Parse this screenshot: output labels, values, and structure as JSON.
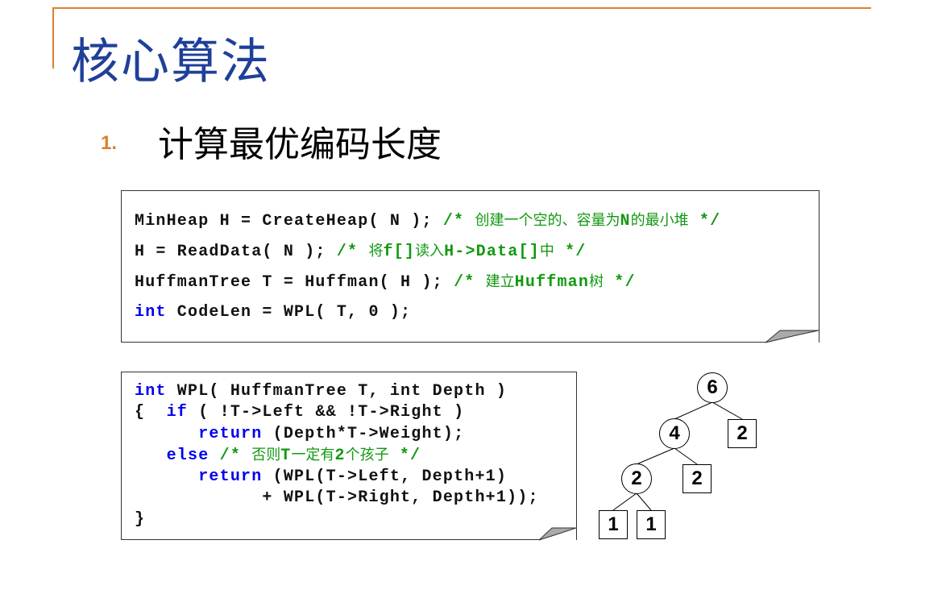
{
  "title": "核心算法",
  "section": {
    "number": "1.",
    "heading": "计算最优编码长度"
  },
  "colors": {
    "accent": "#d9822b",
    "title": "#1f3f99",
    "keyword": "#0000ee",
    "comment": "#119911"
  },
  "code_block_1": [
    [
      {
        "t": "MinHeap H = CreateHeap( N ); ",
        "c": ""
      },
      {
        "t": "/* ",
        "c": "cm"
      },
      {
        "t": "创建一个空的、容量为",
        "c": "cm zh"
      },
      {
        "t": "N",
        "c": "cm"
      },
      {
        "t": "的最小堆",
        "c": "cm zh"
      },
      {
        "t": " */",
        "c": "cm"
      }
    ],
    [
      {
        "t": "H = ReadData( N ); ",
        "c": ""
      },
      {
        "t": "/* ",
        "c": "cm"
      },
      {
        "t": "将",
        "c": "cm zh"
      },
      {
        "t": "f[]",
        "c": "cm"
      },
      {
        "t": "读入",
        "c": "cm zh"
      },
      {
        "t": "H->Data[]",
        "c": "cm"
      },
      {
        "t": "中",
        "c": "cm zh"
      },
      {
        "t": " */",
        "c": "cm"
      }
    ],
    [
      {
        "t": "HuffmanTree T = Huffman( H ); ",
        "c": ""
      },
      {
        "t": "/* ",
        "c": "cm"
      },
      {
        "t": "建立",
        "c": "cm zh"
      },
      {
        "t": "Huffman",
        "c": "cm"
      },
      {
        "t": "树",
        "c": "cm zh"
      },
      {
        "t": " */",
        "c": "cm"
      }
    ],
    [
      {
        "t": "int",
        "c": "kw"
      },
      {
        "t": " CodeLen = WPL( T, 0 );",
        "c": ""
      }
    ]
  ],
  "code_block_2": [
    [
      {
        "t": "int",
        "c": "kw"
      },
      {
        "t": " WPL( HuffmanTree T, int Depth )",
        "c": ""
      }
    ],
    [
      {
        "t": "{  ",
        "c": ""
      },
      {
        "t": "if",
        "c": "kw"
      },
      {
        "t": " ( !T->Left && !T->Right )",
        "c": ""
      }
    ],
    [
      {
        "t": "      ",
        "c": ""
      },
      {
        "t": "return",
        "c": "kw"
      },
      {
        "t": " (Depth*T->Weight);",
        "c": ""
      }
    ],
    [
      {
        "t": "   ",
        "c": ""
      },
      {
        "t": "else",
        "c": "kw"
      },
      {
        "t": " /* ",
        "c": "cm"
      },
      {
        "t": "否则",
        "c": "cm zh"
      },
      {
        "t": "T",
        "c": "cm"
      },
      {
        "t": "一定有",
        "c": "cm zh"
      },
      {
        "t": "2",
        "c": "cm"
      },
      {
        "t": "个孩子",
        "c": "cm zh"
      },
      {
        "t": " */",
        "c": "cm"
      }
    ],
    [
      {
        "t": "      ",
        "c": ""
      },
      {
        "t": "return",
        "c": "kw"
      },
      {
        "t": " (WPL(T->Left, Depth+1)",
        "c": ""
      }
    ],
    [
      {
        "t": "            + WPL(T->Right, Depth+1));",
        "c": ""
      }
    ],
    [
      {
        "t": "}",
        "c": ""
      }
    ]
  ],
  "tree": {
    "nodes": [
      {
        "id": "root",
        "value": "6",
        "shape": "circle"
      },
      {
        "id": "n4",
        "value": "4",
        "shape": "circle"
      },
      {
        "id": "leaf2a",
        "value": "2",
        "shape": "box"
      },
      {
        "id": "n2",
        "value": "2",
        "shape": "circle"
      },
      {
        "id": "leaf2b",
        "value": "2",
        "shape": "box"
      },
      {
        "id": "leaf1a",
        "value": "1",
        "shape": "box"
      },
      {
        "id": "leaf1b",
        "value": "1",
        "shape": "box"
      }
    ],
    "edges": [
      [
        "root",
        "n4"
      ],
      [
        "root",
        "leaf2a"
      ],
      [
        "n4",
        "n2"
      ],
      [
        "n4",
        "leaf2b"
      ],
      [
        "n2",
        "leaf1a"
      ],
      [
        "n2",
        "leaf1b"
      ]
    ]
  }
}
